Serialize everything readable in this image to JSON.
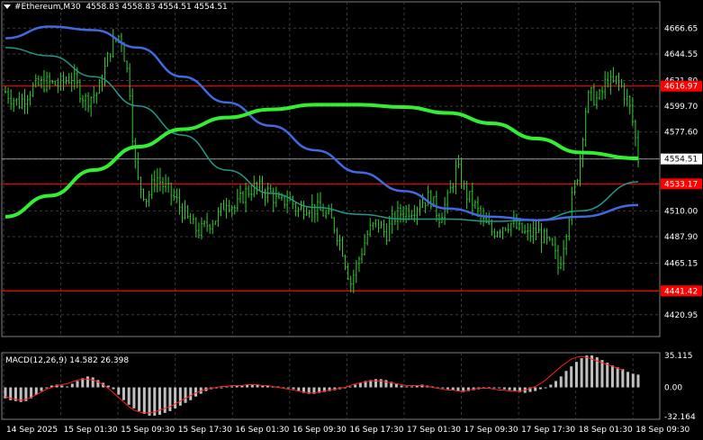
{
  "header": {
    "symbol_label": "#Ethereum,M30",
    "ohlc": "4558.83 4558.83 4554.51 4554.51"
  },
  "colors": {
    "background": "#000000",
    "candle": "#32cd32",
    "ma_fast": "#1f9a8a",
    "ma_mid": "#4169e1",
    "ma_slow": "#33ee33",
    "level_line": "#ff0000",
    "grid": "#3a3a3a",
    "macd_hist": "#c0c0c0",
    "macd_signal": "#ff2020"
  },
  "chart_data": [
    {
      "type": "candlestick",
      "title": "#Ethereum,M30",
      "ylim": [
        4410,
        4680
      ],
      "y_ticks": [
        "4666.65",
        "4644.55",
        "4621.80",
        "4599.70",
        "4577.60",
        "4554.51",
        "4533.17",
        "4510.00",
        "4487.90",
        "4465.15",
        "4441.42",
        "4420.95"
      ],
      "x_ticks": [
        "14 Sep 2025",
        "15 Sep 01:30",
        "15 Sep 09:30",
        "15 Sep 17:30",
        "16 Sep 01:30",
        "16 Sep 09:30",
        "16 Sep 17:30",
        "17 Sep 01:30",
        "17 Sep 09:30",
        "17 Sep 17:30",
        "18 Sep 01:30",
        "18 Sep 09:30"
      ],
      "current_price": 4554.51,
      "levels": [
        4616.97,
        4533.17,
        4441.42
      ],
      "series": [
        {
          "name": "price",
          "points": [
            [
              0,
              4612
            ],
            [
              3,
              4602
            ],
            [
              6,
              4615
            ],
            [
              9,
              4620
            ],
            [
              12,
              4618
            ],
            [
              15,
              4625
            ],
            [
              18,
              4605
            ],
            [
              21,
              4612
            ],
            [
              24,
              4652
            ],
            [
              26,
              4662
            ],
            [
              27,
              4640
            ],
            [
              28,
              4620
            ],
            [
              29,
              4560
            ],
            [
              30,
              4535
            ],
            [
              32,
              4520
            ],
            [
              34,
              4540
            ],
            [
              36,
              4530
            ],
            [
              38,
              4522
            ],
            [
              40,
              4510
            ],
            [
              42,
              4498
            ],
            [
              44,
              4492
            ],
            [
              46,
              4500
            ],
            [
              48,
              4505
            ],
            [
              50,
              4520
            ],
            [
              52,
              4512
            ],
            [
              54,
              4525
            ],
            [
              56,
              4530
            ],
            [
              58,
              4528
            ],
            [
              60,
              4525
            ],
            [
              62,
              4515
            ],
            [
              64,
              4522
            ],
            [
              66,
              4510
            ],
            [
              68,
              4515
            ],
            [
              70,
              4512
            ],
            [
              72,
              4508
            ],
            [
              74,
              4500
            ],
            [
              76,
              4480
            ],
            [
              78,
              4448
            ],
            [
              80,
              4470
            ],
            [
              82,
              4492
            ],
            [
              84,
              4500
            ],
            [
              86,
              4490
            ],
            [
              88,
              4505
            ],
            [
              90,
              4510
            ],
            [
              92,
              4512
            ],
            [
              94,
              4518
            ],
            [
              96,
              4522
            ],
            [
              98,
              4505
            ],
            [
              100,
              4520
            ],
            [
              102,
              4548
            ],
            [
              104,
              4525
            ],
            [
              106,
              4515
            ],
            [
              108,
              4500
            ],
            [
              110,
              4492
            ],
            [
              112,
              4497
            ],
            [
              114,
              4500
            ],
            [
              116,
              4494
            ],
            [
              118,
              4489
            ],
            [
              120,
              4493
            ],
            [
              122,
              4485
            ],
            [
              124,
              4475
            ],
            [
              125,
              4460
            ],
            [
              126,
              4480
            ],
            [
              127,
              4500
            ],
            [
              128,
              4520
            ],
            [
              129,
              4535
            ],
            [
              130,
              4560
            ],
            [
              131,
              4595
            ],
            [
              132,
              4610
            ],
            [
              133,
              4607
            ],
            [
              134,
              4605
            ],
            [
              135,
              4613
            ],
            [
              136,
              4625
            ],
            [
              137,
              4617
            ],
            [
              138,
              4622
            ],
            [
              139,
              4618
            ],
            [
              140,
              4610
            ],
            [
              141,
              4600
            ],
            [
              142,
              4582
            ],
            [
              143,
              4555
            ]
          ]
        },
        {
          "name": "ma_fast",
          "points": [
            [
              0,
              4650
            ],
            [
              10,
              4643
            ],
            [
              20,
              4625
            ],
            [
              30,
              4600
            ],
            [
              40,
              4575
            ],
            [
              50,
              4545
            ],
            [
              60,
              4525
            ],
            [
              70,
              4513
            ],
            [
              80,
              4507
            ],
            [
              90,
              4503
            ],
            [
              100,
              4503
            ],
            [
              110,
              4501
            ],
            [
              120,
              4502
            ],
            [
              130,
              4510
            ],
            [
              143,
              4535
            ]
          ]
        },
        {
          "name": "ma_mid",
          "points": [
            [
              0,
              4658
            ],
            [
              10,
              4668
            ],
            [
              20,
              4665
            ],
            [
              30,
              4650
            ],
            [
              40,
              4625
            ],
            [
              50,
              4603
            ],
            [
              60,
              4583
            ],
            [
              70,
              4562
            ],
            [
              80,
              4543
            ],
            [
              90,
              4527
            ],
            [
              100,
              4512
            ],
            [
              110,
              4505
            ],
            [
              120,
              4502
            ],
            [
              130,
              4505
            ],
            [
              143,
              4515
            ]
          ]
        },
        {
          "name": "ma_slow",
          "points": [
            [
              0,
              4505
            ],
            [
              10,
              4523
            ],
            [
              20,
              4545
            ],
            [
              30,
              4565
            ],
            [
              40,
              4580
            ],
            [
              50,
              4590
            ],
            [
              60,
              4597
            ],
            [
              70,
              4601
            ],
            [
              80,
              4601
            ],
            [
              90,
              4599
            ],
            [
              100,
              4594
            ],
            [
              110,
              4585
            ],
            [
              120,
              4572
            ],
            [
              130,
              4560
            ],
            [
              143,
              4555
            ]
          ]
        }
      ]
    },
    {
      "type": "bar",
      "title": "MACD(12,26,9) 14.582 26.398",
      "ylim": [
        -35,
        38
      ],
      "y_ticks": [
        "35.115",
        "0.00",
        "-32.164"
      ],
      "series": [
        {
          "name": "histogram",
          "values": [
            -12,
            -14,
            -15,
            -16,
            -15,
            -12,
            -8,
            -4,
            -1,
            2,
            3,
            2,
            1,
            4,
            7,
            10,
            12,
            11,
            8,
            5,
            2,
            -2,
            -8,
            -14,
            -19,
            -23,
            -26,
            -29,
            -31,
            -31,
            -30,
            -28,
            -26,
            -23,
            -20,
            -17,
            -14,
            -10,
            -7,
            -4,
            -2,
            -1,
            0,
            1,
            1,
            2,
            2,
            3,
            3,
            3,
            2,
            2,
            1,
            1,
            0,
            -1,
            -2,
            -4,
            -6,
            -7,
            -7,
            -6,
            -5,
            -4,
            -3,
            -2,
            -1,
            1,
            3,
            5,
            7,
            8,
            9,
            9,
            8,
            6,
            4,
            2,
            1,
            1,
            2,
            3,
            2,
            1,
            0,
            -1,
            -2,
            -3,
            -4,
            -5,
            -4,
            -3,
            -2,
            -1,
            0,
            0,
            -1,
            -2,
            -3,
            -4,
            -5,
            -6,
            -5,
            -4,
            -2,
            0,
            3,
            7,
            12,
            18,
            23,
            28,
            32,
            35,
            35,
            33,
            30,
            27,
            24,
            22,
            20,
            17,
            15,
            14
          ]
        },
        {
          "name": "signal",
          "values": [
            -10,
            -12,
            -13,
            -14,
            -13,
            -11,
            -8,
            -5,
            -2,
            0,
            2,
            3,
            4,
            6,
            8,
            9,
            9,
            8,
            6,
            3,
            -1,
            -6,
            -11,
            -16,
            -21,
            -25,
            -27,
            -28,
            -28,
            -27,
            -25,
            -23,
            -21,
            -18,
            -15,
            -12,
            -9,
            -6,
            -4,
            -2,
            -1,
            0,
            1,
            1,
            2,
            2,
            2,
            3,
            3,
            3,
            2,
            2,
            1,
            0,
            -1,
            -2,
            -3,
            -4,
            -5,
            -6,
            -6,
            -5,
            -4,
            -3,
            -2,
            -1,
            0,
            2,
            4,
            5,
            6,
            7,
            7,
            7,
            6,
            5,
            4,
            3,
            2,
            2,
            2,
            2,
            1,
            0,
            -1,
            -2,
            -3,
            -3,
            -4,
            -4,
            -3,
            -2,
            -1,
            -1,
            -1,
            -2,
            -3,
            -3,
            -4,
            -4,
            -4,
            -3,
            -1,
            1,
            4,
            8,
            13,
            18,
            23,
            27,
            31,
            33,
            34,
            33,
            31,
            29,
            27,
            25,
            23,
            21,
            19
          ]
        }
      ]
    }
  ]
}
